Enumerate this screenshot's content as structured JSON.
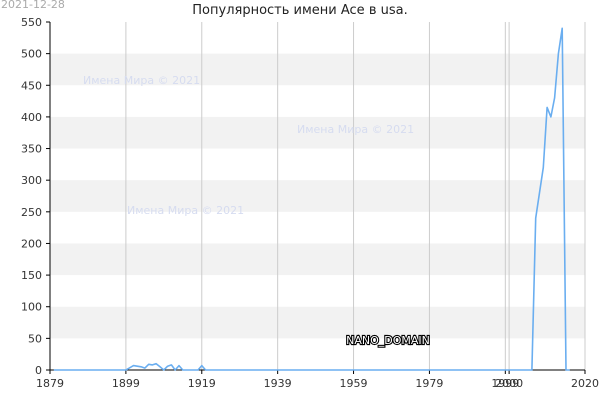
{
  "header": {
    "title": "Популярность имени Ace в usa.",
    "date_stamp": "2021-12-28"
  },
  "watermarks": [
    "Имена Мира © 2021",
    "Имена Мира © 2021",
    "Имена Мира © 2021"
  ],
  "footer_label": "NANO_DOMAIN",
  "colors": {
    "line": "#6aaef0",
    "band": "#f2f2f2",
    "grid": "#cccccc",
    "axis": "#000000"
  },
  "chart_data": {
    "type": "line",
    "title": "Популярность имени Ace в usa.",
    "xlabel": "",
    "ylabel": "",
    "xlim": [
      1879,
      2020
    ],
    "ylim": [
      0,
      550
    ],
    "x_ticks": [
      1879,
      1899,
      1919,
      1939,
      1959,
      1979,
      1999,
      2000,
      2020
    ],
    "y_ticks": [
      0,
      50,
      100,
      150,
      200,
      250,
      300,
      350,
      400,
      450,
      500,
      550
    ],
    "grid": true,
    "legend": "none",
    "series": [
      {
        "x": [
          1880,
          1899,
          1901,
          1903,
          1904,
          1905,
          1906,
          1907,
          1908,
          1909,
          1910,
          1911,
          1912,
          1913,
          1914,
          1915,
          1918,
          1919,
          1920,
          1925,
          1950,
          1980,
          2000,
          2006,
          2007,
          2008,
          2009,
          2010,
          2011,
          2012,
          2013,
          2014,
          2015,
          2016
        ],
        "values": [
          0,
          0,
          7,
          5,
          3,
          9,
          8,
          10,
          5,
          0,
          6,
          8,
          0,
          7,
          0,
          0,
          0,
          7,
          0,
          0,
          0,
          0,
          0,
          0,
          240,
          280,
          320,
          415,
          400,
          430,
          500,
          540,
          0,
          0
        ]
      }
    ]
  }
}
